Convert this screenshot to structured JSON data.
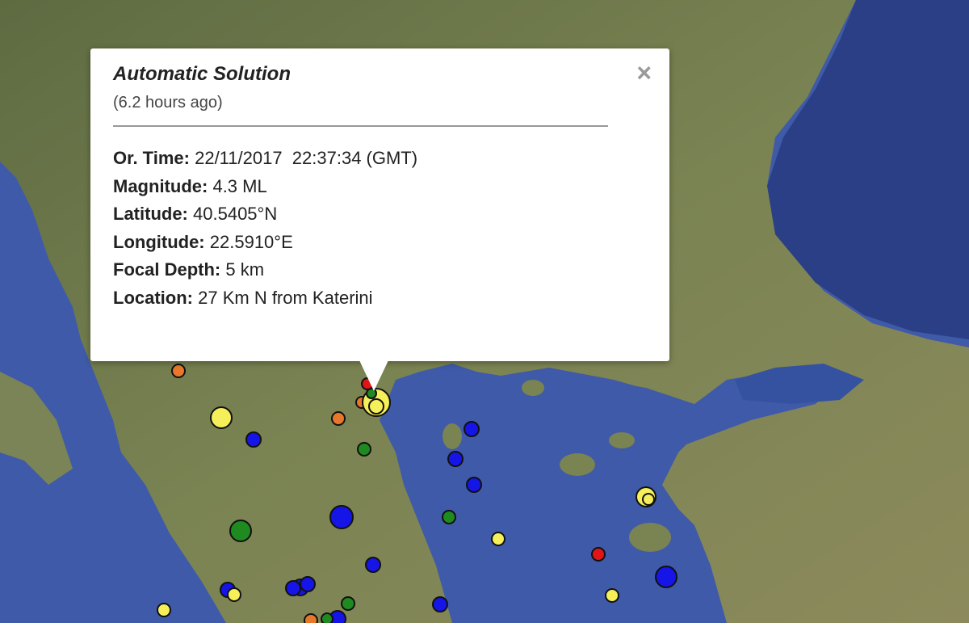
{
  "popup": {
    "title": "Automatic Solution",
    "ago": "(6.2 hours ago)",
    "close_symbol": "×",
    "fields": [
      {
        "label": "Or. Time:",
        "value": "22/11/2017  22:37:34 (GMT)"
      },
      {
        "label": "Magnitude:",
        "value": "4.3 ML"
      },
      {
        "label": "Latitude:",
        "value": "40.5405°N"
      },
      {
        "label": "Longitude:",
        "value": "22.5910°E"
      },
      {
        "label": "Focal Depth:",
        "value": "5 km"
      },
      {
        "label": "Location:",
        "value": "27 Km N from Katerini"
      }
    ]
  },
  "colors": {
    "sea": "#3f5aa8",
    "land": "#6f7a4f",
    "marker_yellow": "#f5ef5a",
    "marker_blue": "#1515e8",
    "marker_green": "#1f8a1f",
    "marker_orange": "#e8772a",
    "marker_red": "#e01515"
  }
}
